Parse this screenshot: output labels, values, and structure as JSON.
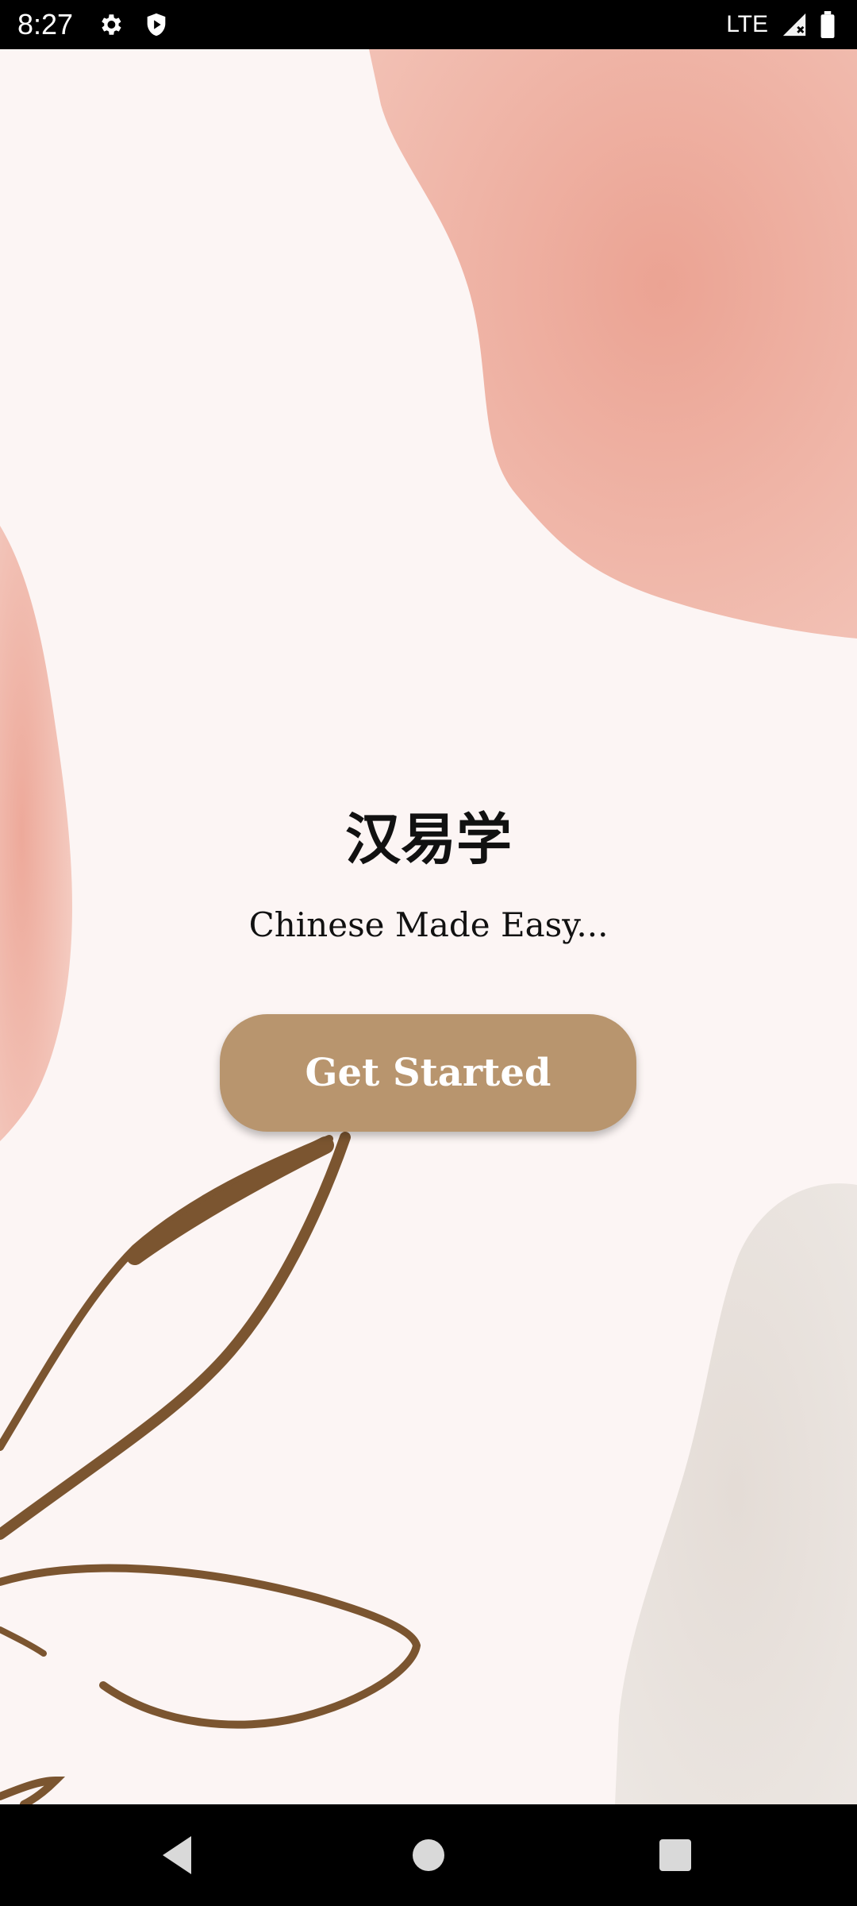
{
  "status_bar": {
    "time": "8:27",
    "left_icons": [
      "settings-icon",
      "shield-play-icon"
    ],
    "network_label": "LTE",
    "right_icons": [
      "signal-icon",
      "battery-icon"
    ]
  },
  "app": {
    "title": "汉易学",
    "subtitle": "Chinese Made Easy...",
    "cta_label": "Get Started",
    "colors": {
      "background": "#fcf5f4",
      "button": "#b8956e",
      "blush": "#efb5a8",
      "stem": "#7b5530",
      "stone": "#e8e1dc"
    }
  },
  "nav_bar": {
    "buttons": [
      "back-icon",
      "home-icon",
      "recents-icon"
    ]
  }
}
